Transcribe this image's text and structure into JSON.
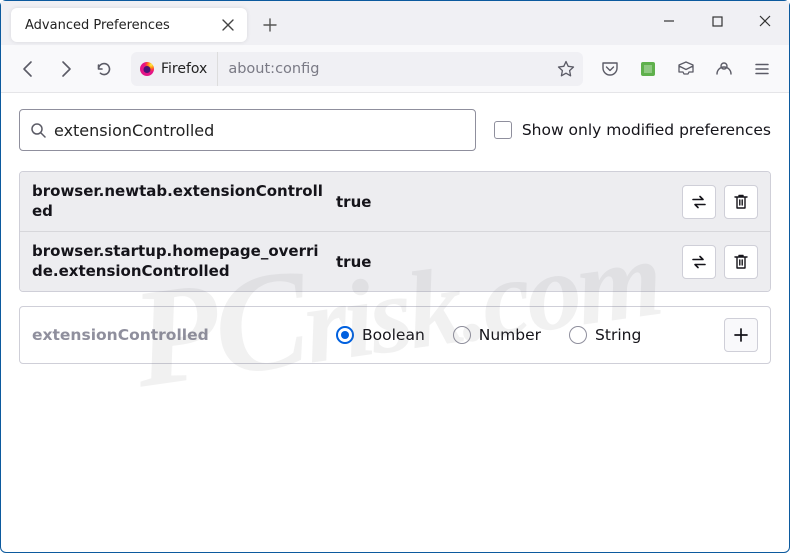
{
  "window": {
    "tab_title": "Advanced Preferences"
  },
  "urlbar": {
    "identity_label": "Firefox",
    "url": "about:config"
  },
  "config": {
    "search_value": "extensionControlled",
    "show_modified_label": "Show only modified preferences",
    "prefs": [
      {
        "name": "browser.newtab.extensionControlled",
        "value": "true"
      },
      {
        "name": "browser.startup.homepage_override.extensionControlled",
        "value": "true"
      }
    ],
    "new_pref": {
      "name": "extensionControlled",
      "types": {
        "boolean": "Boolean",
        "number": "Number",
        "string": "String"
      }
    }
  }
}
